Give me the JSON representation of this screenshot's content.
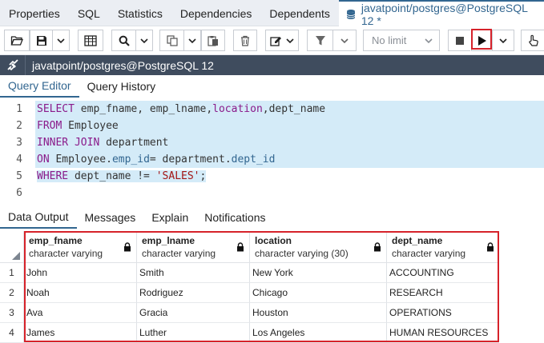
{
  "top_tabs": [
    "Properties",
    "SQL",
    "Statistics",
    "Dependencies",
    "Dependents"
  ],
  "active_tab": {
    "label": "javatpoint/postgres@PostgreSQL 12 *"
  },
  "toolbar": {
    "limit_placeholder": "No limit"
  },
  "connection": {
    "label": "javatpoint/postgres@PostgreSQL 12"
  },
  "editor_tabs": [
    "Query Editor",
    "Query History"
  ],
  "editor": {
    "line_numbers": [
      "1",
      "2",
      "3",
      "4",
      "5",
      "6"
    ]
  },
  "result_tabs": [
    "Data Output",
    "Messages",
    "Explain",
    "Notifications"
  ],
  "grid": {
    "columns": [
      {
        "name": "emp_fname",
        "type": "character varying"
      },
      {
        "name": "emp_lname",
        "type": "character varying"
      },
      {
        "name": "location",
        "type": "character varying (30)"
      },
      {
        "name": "dept_name",
        "type": "character varying"
      }
    ],
    "rows": [
      {
        "num": "1",
        "cells": [
          "John",
          "Smith",
          "New York",
          "ACCOUNTING"
        ]
      },
      {
        "num": "2",
        "cells": [
          "Noah",
          "Rodriguez",
          "Chicago",
          "RESEARCH"
        ]
      },
      {
        "num": "3",
        "cells": [
          "Ava",
          "Gracia",
          "Houston",
          "OPERATIONS"
        ]
      },
      {
        "num": "4",
        "cells": [
          "James",
          "Luther",
          "Los Angeles",
          "HUMAN RESOURCES"
        ]
      }
    ]
  },
  "colors": {
    "accent": "#326690",
    "connection_bar": "#3f4c5e",
    "highlight": "#d6222a",
    "selection": "#d4ebf8",
    "keyword": "#8a1a8a",
    "string": "#a31515"
  }
}
